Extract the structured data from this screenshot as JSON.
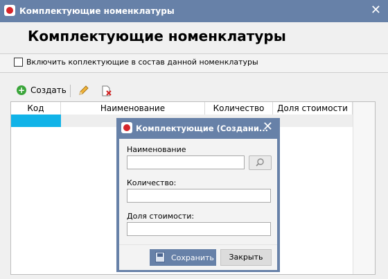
{
  "window": {
    "title": "Комплектующие номенклатуры",
    "close_glyph": "✕"
  },
  "page": {
    "heading": "Комплектующие номенклатуры",
    "include_checkbox_label": "Включить коплектующие в состав данной номенклатуры",
    "include_checked": false
  },
  "toolbar": {
    "create_label": "Создать",
    "create_icon": "plus-circle-icon",
    "edit_icon": "pencil-icon",
    "delete_icon": "delete-record-icon"
  },
  "grid": {
    "columns": [
      "Код",
      "Наименование",
      "Количество",
      "Доля стоимости"
    ],
    "row_highlight_color": "#11b3e8"
  },
  "dialog": {
    "title": "Комплектующие (Создани...",
    "close_glyph": "✕",
    "name_label": "Наименование",
    "name_value": "",
    "lookup_icon": "magnifier-icon",
    "quantity_label": "Количество:",
    "quantity_value": "",
    "share_label": "Доля стоимости:",
    "share_value": "",
    "save_label": "Сохранить",
    "close_label": "Закрыть"
  },
  "colors": {
    "titlebar": "#6781a8",
    "accent": "#6781a8"
  }
}
